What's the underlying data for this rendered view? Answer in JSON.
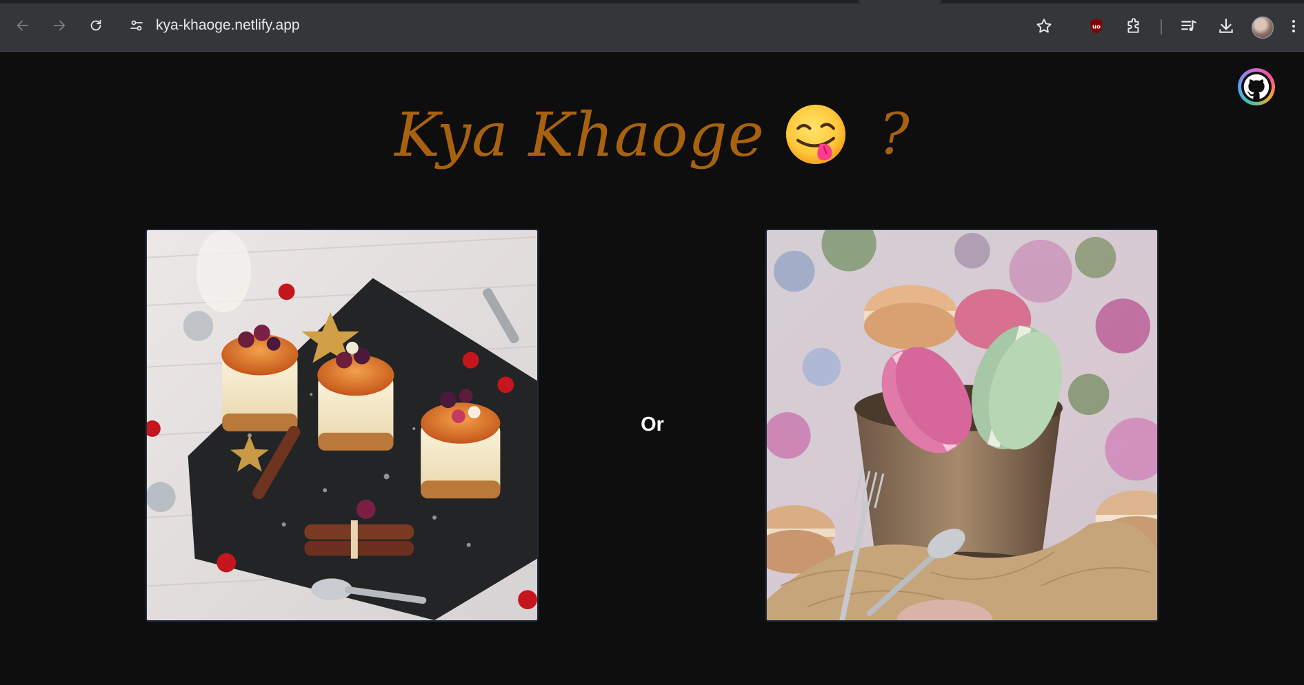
{
  "browser": {
    "url": "kya-khaoge.netlify.app",
    "icons": [
      "back-arrow-icon",
      "forward-arrow-icon",
      "reload-icon",
      "site-settings-icon",
      "bookmark-star-icon",
      "ublock-shield-icon",
      "extensions-puzzle-icon",
      "media-queue-icon",
      "download-icon",
      "profile-avatar",
      "menu-kebab-icon"
    ]
  },
  "page": {
    "title": "Kya Khaoge",
    "title_emoji": "face-savoring-food-emoji",
    "question_mark": "?",
    "or_label": "Or",
    "title_color": "#a8620f",
    "background_color": "#0e0e0f",
    "github_icon": "github-icon",
    "choices": [
      {
        "name": "cheesecakes",
        "image": "mini-cheesecakes-with-berries-image"
      },
      {
        "name": "macarons",
        "image": "macarons-in-copper-cup-image"
      }
    ]
  }
}
